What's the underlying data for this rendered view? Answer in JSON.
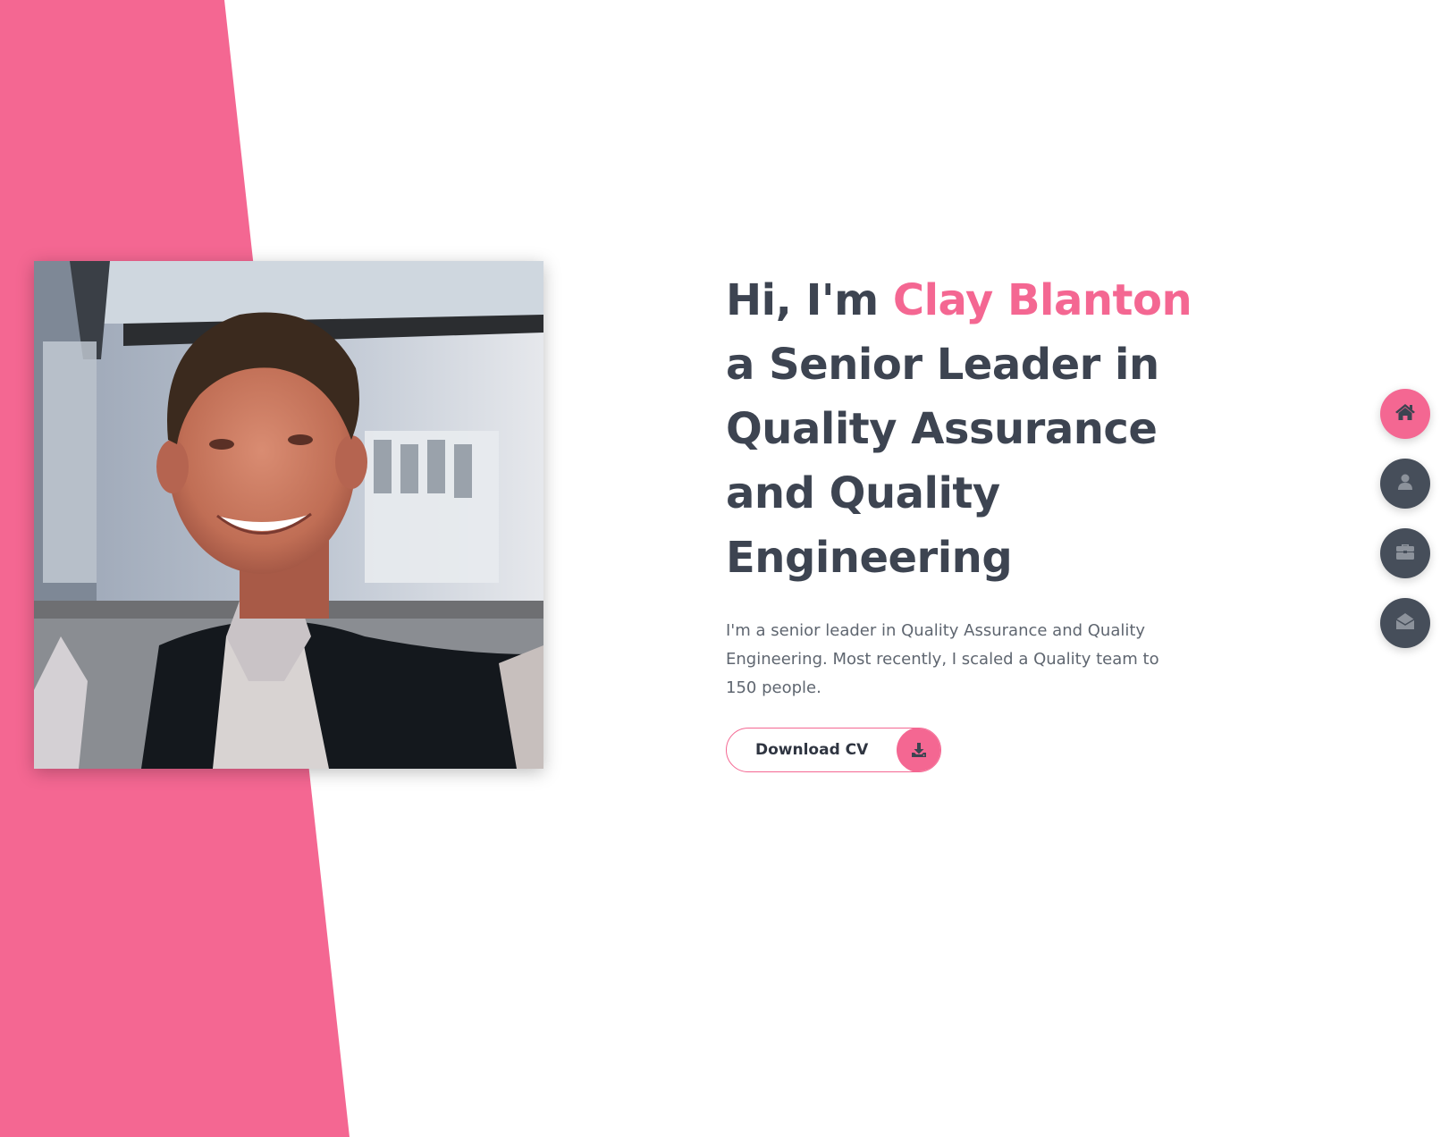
{
  "colors": {
    "accent": "#f46792",
    "heading": "#3d4451",
    "body_text": "#5f6670",
    "nav_button": "#464e5a",
    "icon_dark": "#3d4451",
    "icon_light": "#8c929b"
  },
  "hero": {
    "greeting": "Hi, I'm ",
    "name": "Clay Blanton",
    "title": " a Senior Leader in Quality Assurance and Quality Engineering",
    "intro": "I'm a senior leader in Quality Assurance and Quality Engineering. Most recently, I scaled a Quality team to 150 people."
  },
  "cv_button": {
    "label": "Download CV",
    "icon": "download-icon"
  },
  "photo": {
    "alt": "Clay Blanton"
  },
  "side_nav": {
    "items": [
      {
        "icon": "home-icon",
        "active": true
      },
      {
        "icon": "user-icon",
        "active": false
      },
      {
        "icon": "briefcase-icon",
        "active": false
      },
      {
        "icon": "envelope-open-icon",
        "active": false
      }
    ]
  }
}
